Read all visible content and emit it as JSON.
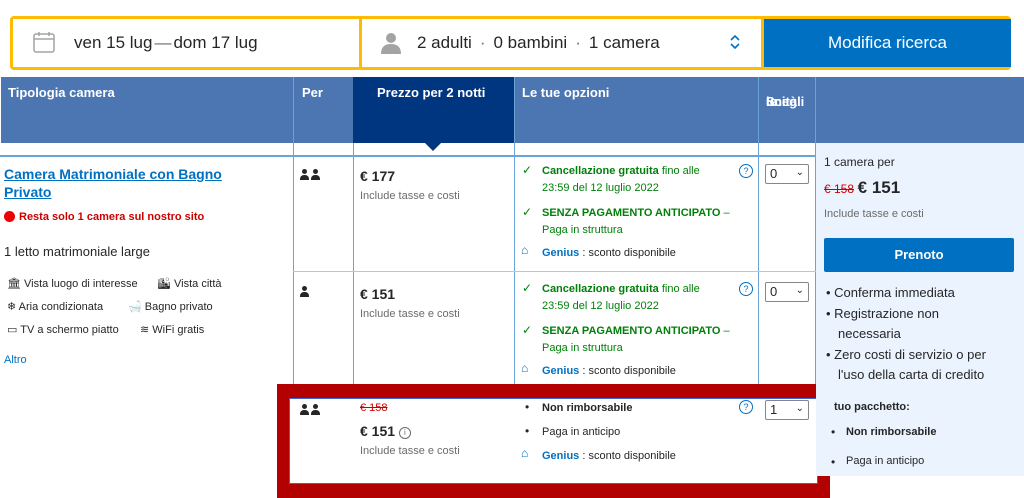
{
  "search": {
    "dates": "ven 15 lug",
    "dates_sep": "—",
    "dates_end": "dom 17 lug",
    "adults": "2 adulti",
    "children": "0 bambini",
    "rooms": "1 camera",
    "dot": "·",
    "button": "Modifica ricerca"
  },
  "header": {
    "room_type": "Tipologia camera",
    "per": "Per",
    "price": "Prezzo per 2 notti",
    "options": "Le tue opzioni",
    "choose1": "Scegli",
    "choose2": "le",
    "choose3": "unità"
  },
  "room": {
    "name1": "Camera Matrimoniale con Bagno",
    "name2": "Privato",
    "urgency": "Resta solo 1 camera sul nostro sito",
    "bed": "1 letto matrimoniale large",
    "amenities": [
      "Vista luogo di interesse",
      "Vista città",
      "Aria condizionata",
      "Bagno privato",
      "TV a schermo piatto",
      "WiFi gratis"
    ],
    "more": "Altro"
  },
  "rows": [
    {
      "price": "€ 177",
      "taxes": "Include tasse e costi",
      "opt1_bold": "Cancellazione gratuita",
      "opt1_rest": " fino alle",
      "opt1_line2": "23:59 del 12 luglio 2022",
      "opt2_bold": "SENZA PAGAMENTO ANTICIPATO",
      "opt2_rest": " –",
      "opt2_line2": "Paga in struttura",
      "genius": "Genius",
      "genius_rest": " : sconto disponibile",
      "select": "0"
    },
    {
      "price": "€ 151",
      "taxes": "Include tasse e costi",
      "opt1_bold": "Cancellazione gratuita",
      "opt1_rest": " fino alle",
      "opt1_line2": "23:59 del 12 luglio 2022",
      "opt2_bold": "SENZA PAGAMENTO ANTICIPATO",
      "opt2_rest": " –",
      "opt2_line2": "Paga in struttura",
      "genius": "Genius",
      "genius_rest": " : sconto disponibile",
      "select": "0"
    },
    {
      "old_price": "€ 158",
      "price": "€ 151",
      "taxes": "Include tasse e costi",
      "opt1": "Non rimborsabile",
      "opt2": "Paga in anticipo",
      "genius": "Genius",
      "genius_rest": " : sconto disponibile",
      "select": "1"
    }
  ],
  "summary": {
    "rooms": "1 camera per",
    "old_price": "€ 158",
    "price": "€ 151",
    "taxes": "Include tasse e costi",
    "button": "Prenoto",
    "bullets": [
      "Conferma immediata",
      "Registrazione non",
      "necessaria",
      "Zero costi di servizio o per",
      "l'uso della carta di credito"
    ],
    "package_title": "tuo pacchetto:",
    "package_1": "Non rimborsabile",
    "package_2": "Paga in anticipo"
  },
  "colors": {
    "brand_blue": "#0071c2",
    "header_blue": "#4c76b2",
    "dark_blue": "#003580",
    "yellow": "#febb02",
    "highlight_red": "#b30000",
    "green": "#008009"
  }
}
